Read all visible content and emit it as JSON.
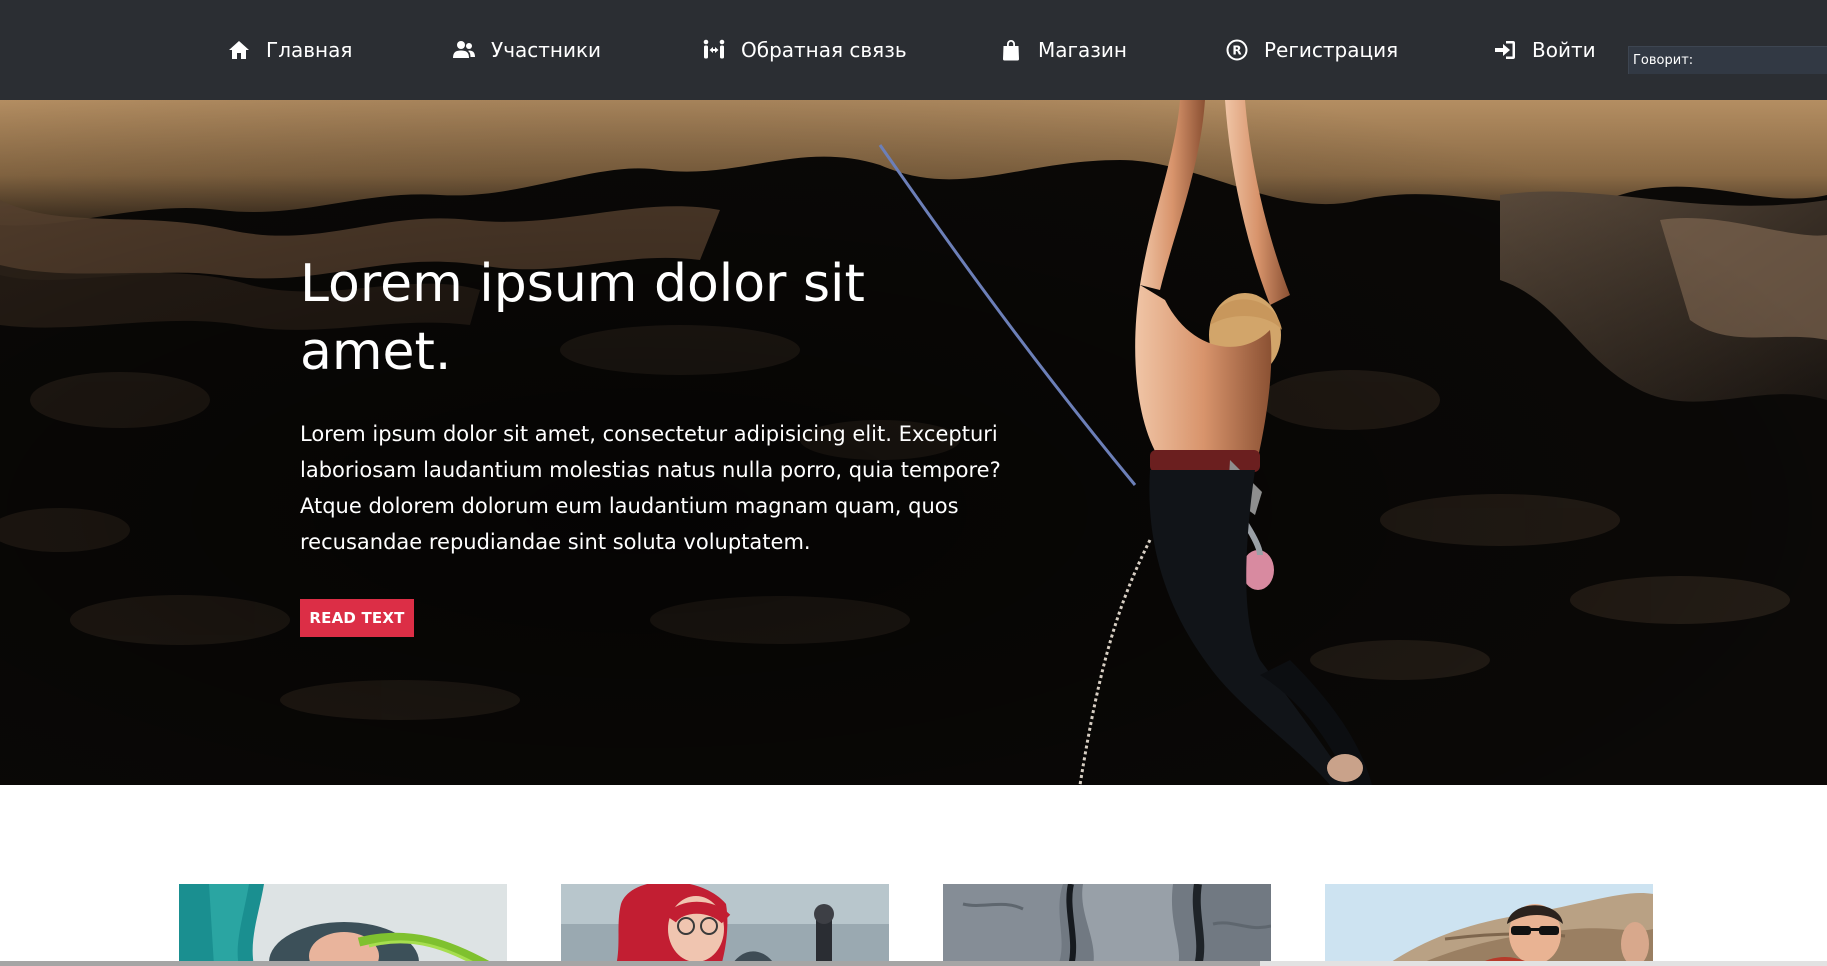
{
  "nav": {
    "items": [
      {
        "label": "Главная",
        "icon": "home-icon"
      },
      {
        "label": "Участники",
        "icon": "users-icon"
      },
      {
        "label": "Обратная связь",
        "icon": "people-arrows-icon"
      },
      {
        "label": "Магазин",
        "icon": "shopping-bag-icon"
      },
      {
        "label": "Регистрация",
        "icon": "registered-icon"
      },
      {
        "label": "Войти",
        "icon": "sign-in-icon"
      }
    ]
  },
  "speech_widget": {
    "label": "Говорит:",
    "value": ""
  },
  "hero": {
    "title": "Lorem ipsum dolor sit amet.",
    "text": "Lorem ipsum dolor sit amet, consectetur adipisicing elit. Excepturi laboriosam laudantium molestias natus nulla porro, quia tempore? Atque dolorem dolorum eum laudantium magnam quam, quos recusandae repudiandae sint soluta voluptatem.",
    "button_label": "READ TEXT",
    "image": "rock-climber-photo"
  },
  "cards": [
    {
      "image": "climbing-rope-photo"
    },
    {
      "image": "red-haired-climber-photo"
    },
    {
      "image": "rock-crack-photo"
    },
    {
      "image": "smiling-climber-photo"
    }
  ],
  "colors": {
    "nav_bg": "#2b2e33",
    "accent": "#dc2e46",
    "text_light": "#ffffff"
  }
}
